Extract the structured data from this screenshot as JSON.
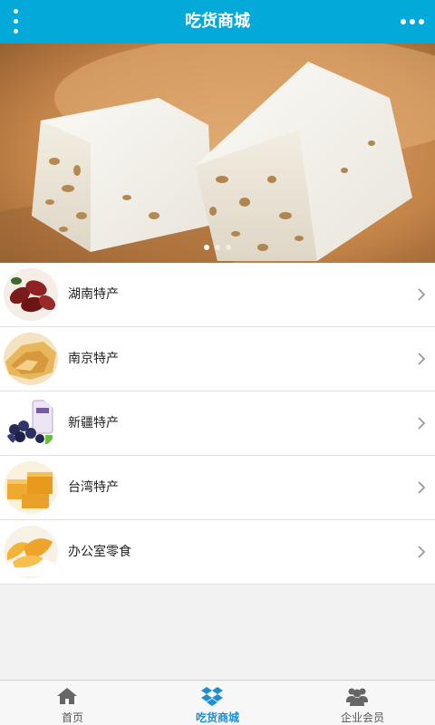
{
  "header": {
    "title": "吃货商城",
    "menu_icon": "vertical-dots-icon",
    "more_icon": "horizontal-dots-icon"
  },
  "banner": {
    "slide_count": 3,
    "active_slide": 1
  },
  "categories": [
    {
      "label": "湖南特产",
      "icon": "chevron-right-icon"
    },
    {
      "label": "南京特产",
      "icon": "chevron-right-icon"
    },
    {
      "label": "新疆特产",
      "icon": "chevron-right-icon"
    },
    {
      "label": "台湾特产",
      "icon": "chevron-right-icon"
    },
    {
      "label": "办公室零食",
      "icon": "chevron-right-icon"
    }
  ],
  "tabbar": {
    "tabs": [
      {
        "label": "首页",
        "icon": "home-icon"
      },
      {
        "label": "吃货商城",
        "icon": "dropbox-icon",
        "active": true
      },
      {
        "label": "企业会员",
        "icon": "users-icon"
      }
    ]
  },
  "colors": {
    "header_bg": "#03a9d8",
    "active_tab": "#1f8fd0"
  }
}
